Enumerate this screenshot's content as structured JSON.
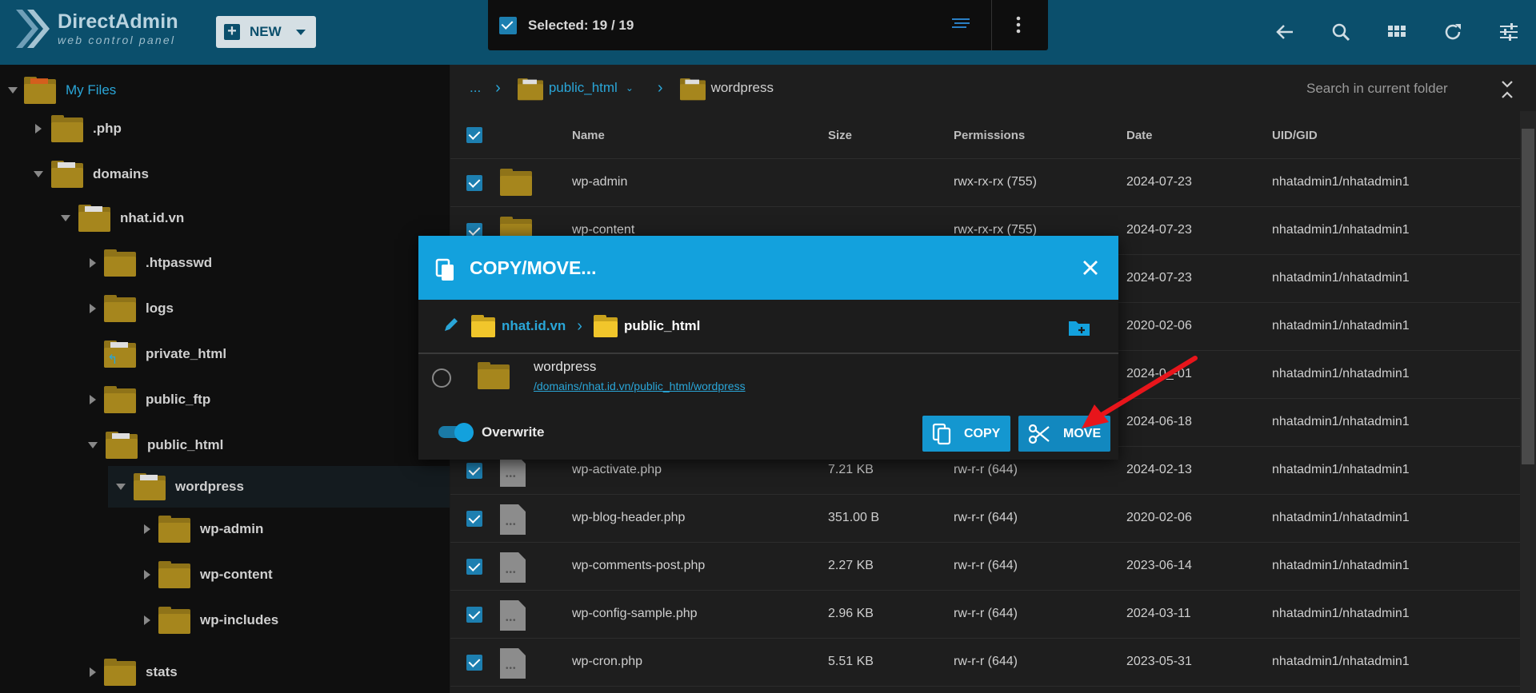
{
  "header": {
    "logo_title": "DirectAdmin",
    "logo_subtitle": "web control panel",
    "new_button": "NEW",
    "selection_text": "Selected: 19 / 19"
  },
  "icons": [
    "back-arrow-icon",
    "search-icon",
    "grid-icon",
    "refresh-icon",
    "settings-sliders-icon"
  ],
  "sidebar": {
    "root": "My Files",
    "items": [
      {
        "label": ".php"
      },
      {
        "label": "domains"
      },
      {
        "label": "nhat.id.vn"
      },
      {
        "label": ".htpasswd"
      },
      {
        "label": "logs"
      },
      {
        "label": "private_html"
      },
      {
        "label": "public_ftp"
      },
      {
        "label": "public_html"
      },
      {
        "label": "wordpress"
      },
      {
        "label": "wp-admin"
      },
      {
        "label": "wp-content"
      },
      {
        "label": "wp-includes"
      },
      {
        "label": "stats"
      }
    ]
  },
  "breadcrumb": {
    "ellipsis": "...",
    "parent": "public_html",
    "current": "wordpress",
    "search_placeholder": "Search in current folder"
  },
  "table": {
    "columns": [
      "Name",
      "Size",
      "Permissions",
      "Date",
      "UID/GID"
    ],
    "rows": [
      {
        "name": "wp-admin",
        "size": "",
        "perm": "rwx-rx-rx (755)",
        "date": "2024-07-23",
        "uid": "nhatadmin1/nhatadmin1",
        "type": "folder"
      },
      {
        "name": "wp-content",
        "size": "",
        "perm": "rwx-rx-rx (755)",
        "date": "2024-07-23",
        "uid": "nhatadmin1/nhatadmin1",
        "type": "folder"
      },
      {
        "name": "",
        "size": "",
        "perm": "",
        "date": "2024-07-23",
        "uid": "nhatadmin1/nhatadmin1",
        "type": "hidden"
      },
      {
        "name": "",
        "size": "",
        "perm": "",
        "date": "2020-02-06",
        "uid": "nhatadmin1/nhatadmin1",
        "type": "hidden"
      },
      {
        "name": "",
        "size": "",
        "perm": "",
        "date": "2024-0_-01",
        "uid": "nhatadmin1/nhatadmin1",
        "type": "hidden"
      },
      {
        "name": "",
        "size": "",
        "perm": "",
        "date": "2024-06-18",
        "uid": "nhatadmin1/nhatadmin1",
        "type": "hidden"
      },
      {
        "name": "wp-activate.php",
        "size": "7.21 KB",
        "perm": "rw-r-r (644)",
        "date": "2024-02-13",
        "uid": "nhatadmin1/nhatadmin1",
        "type": "file"
      },
      {
        "name": "wp-blog-header.php",
        "size": "351.00 B",
        "perm": "rw-r-r (644)",
        "date": "2020-02-06",
        "uid": "nhatadmin1/nhatadmin1",
        "type": "file"
      },
      {
        "name": "wp-comments-post.php",
        "size": "2.27 KB",
        "perm": "rw-r-r (644)",
        "date": "2023-06-14",
        "uid": "nhatadmin1/nhatadmin1",
        "type": "file"
      },
      {
        "name": "wp-config-sample.php",
        "size": "2.96 KB",
        "perm": "rw-r-r (644)",
        "date": "2024-03-11",
        "uid": "nhatadmin1/nhatadmin1",
        "type": "file"
      },
      {
        "name": "wp-cron.php",
        "size": "5.51 KB",
        "perm": "rw-r-r (644)",
        "date": "2023-05-31",
        "uid": "nhatadmin1/nhatadmin1",
        "type": "file"
      }
    ]
  },
  "modal": {
    "title": "COPY/MOVE...",
    "path_parent": "nhat.id.vn",
    "path_current": "public_html",
    "item_name": "wordpress",
    "item_path": "/domains/nhat.id.vn/public_html/wordpress",
    "overwrite_label": "Overwrite",
    "overwrite_on": true,
    "copy_label": "COPY",
    "move_label": "MOVE"
  },
  "colors": {
    "topbar": "#0b4f6c",
    "accent": "#13a1dd",
    "folder": "#a6861d",
    "annotation_arrow": "#e8151b"
  }
}
